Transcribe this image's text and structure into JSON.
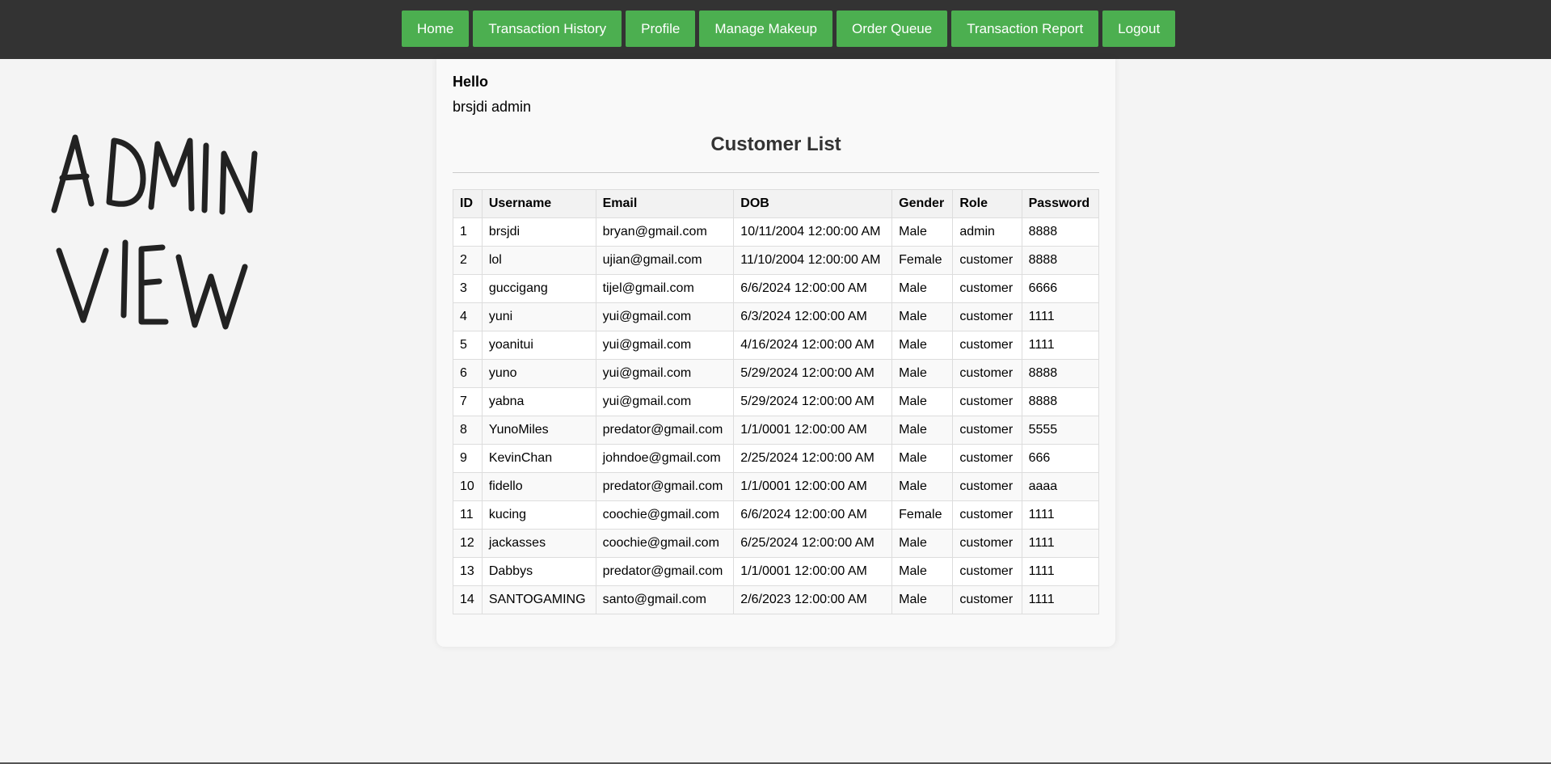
{
  "nav": {
    "items": [
      "Home",
      "Transaction History",
      "Profile",
      "Manage Makeup",
      "Order Queue",
      "Transaction Report",
      "Logout"
    ]
  },
  "doodle": {
    "text": "ADMIN VIEW"
  },
  "greeting": {
    "hello": "Hello",
    "user": "brsjdi admin"
  },
  "customer_list": {
    "title": "Customer List",
    "columns": [
      "ID",
      "Username",
      "Email",
      "DOB",
      "Gender",
      "Role",
      "Password"
    ],
    "rows": [
      [
        "1",
        "brsjdi",
        "bryan@gmail.com",
        "10/11/2004 12:00:00 AM",
        "Male",
        "admin",
        "8888"
      ],
      [
        "2",
        "lol",
        "ujian@gmail.com",
        "11/10/2004 12:00:00 AM",
        "Female",
        "customer",
        "8888"
      ],
      [
        "3",
        "guccigang",
        "tijel@gmail.com",
        "6/6/2024 12:00:00 AM",
        "Male",
        "customer",
        "6666"
      ],
      [
        "4",
        "yuni",
        "yui@gmail.com",
        "6/3/2024 12:00:00 AM",
        "Male",
        "customer",
        "1111"
      ],
      [
        "5",
        "yoanitui",
        "yui@gmail.com",
        "4/16/2024 12:00:00 AM",
        "Male",
        "customer",
        "1111"
      ],
      [
        "6",
        "yuno",
        "yui@gmail.com",
        "5/29/2024 12:00:00 AM",
        "Male",
        "customer",
        "8888"
      ],
      [
        "7",
        "yabna",
        "yui@gmail.com",
        "5/29/2024 12:00:00 AM",
        "Male",
        "customer",
        "8888"
      ],
      [
        "8",
        "YunoMiles",
        "predator@gmail.com",
        "1/1/0001 12:00:00 AM",
        "Male",
        "customer",
        "5555"
      ],
      [
        "9",
        "KevinChan",
        "johndoe@gmail.com",
        "2/25/2024 12:00:00 AM",
        "Male",
        "customer",
        "666"
      ],
      [
        "10",
        "fidello",
        "predator@gmail.com",
        "1/1/0001 12:00:00 AM",
        "Male",
        "customer",
        "aaaa"
      ],
      [
        "11",
        "kucing",
        "coochie@gmail.com",
        "6/6/2024 12:00:00 AM",
        "Female",
        "customer",
        "1111"
      ],
      [
        "12",
        "jackasses",
        "coochie@gmail.com",
        "6/25/2024 12:00:00 AM",
        "Male",
        "customer",
        "1111"
      ],
      [
        "13",
        "Dabbys",
        "predator@gmail.com",
        "1/1/0001 12:00:00 AM",
        "Male",
        "customer",
        "1111"
      ],
      [
        "14",
        "SANTOGAMING",
        "santo@gmail.com",
        "2/6/2023 12:00:00 AM",
        "Male",
        "customer",
        "1111"
      ]
    ]
  },
  "colors": {
    "nav_bar": "#333333",
    "nav_button": "#4caf50",
    "page_bg": "#f4f4f4",
    "card_bg": "#f9f9f9"
  }
}
